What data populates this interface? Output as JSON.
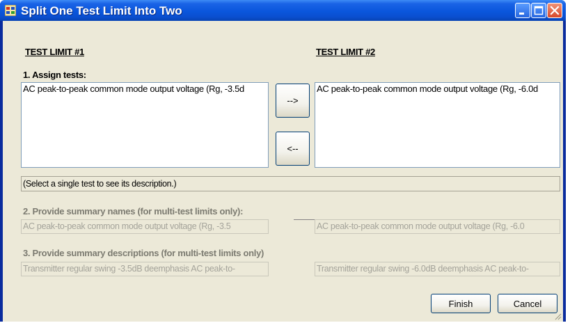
{
  "window": {
    "title": "Split One Test Limit Into Two",
    "buttons": [
      "minimize-icon",
      "maximize-icon",
      "close-icon"
    ]
  },
  "limit1": {
    "header": "TEST LIMIT #1"
  },
  "limit2": {
    "header": "TEST LIMIT #2"
  },
  "section1": {
    "label": "1. Assign tests:"
  },
  "list1": {
    "items": [
      "AC peak-to-peak common mode output voltage (Rg, -3.5d"
    ]
  },
  "list2": {
    "items": [
      "AC peak-to-peak common mode output voltage (Rg, -6.0d"
    ]
  },
  "move_right_label": "-->",
  "move_left_label": "<--",
  "description": "(Select a single test to see its description.)",
  "section2": {
    "label": "2. Provide summary names (for multi-test limits only):",
    "name1": "AC peak-to-peak common mode output voltage (Rg, -3.5",
    "name2": "AC peak-to-peak common mode output voltage (Rg, -6.0"
  },
  "section3": {
    "label": "3. Provide summary descriptions (for multi-test limits only)",
    "desc1": "Transmitter regular swing -3.5dB deemphasis AC peak-to-",
    "desc2": "Transmitter regular swing -6.0dB deemphasis AC peak-to-"
  },
  "finish_label": "Finish",
  "cancel_label": "Cancel",
  "colors": {
    "titlebar": "#0a56dc",
    "dialog_bg": "#ece9d8",
    "close_button": "#d8482a"
  }
}
